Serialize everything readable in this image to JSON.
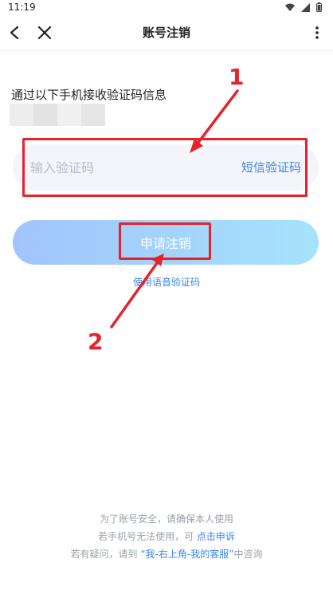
{
  "status_bar": {
    "time": "11:19"
  },
  "nav": {
    "title": "账号注销"
  },
  "info": {
    "text": "通过以下手机接收验证码信息"
  },
  "code_field": {
    "placeholder": "输入验证码",
    "sms_label": "短信验证码"
  },
  "apply_button": {
    "label": "申请注销"
  },
  "voice_link": {
    "label": "使用语音验证码"
  },
  "annotations": {
    "one": "1",
    "two": "2"
  },
  "footer": {
    "line1": "为了账号安全，请确保本人使用",
    "line2_prefix": "若手机号无法使用，可 ",
    "line2_link": "点击申诉",
    "line3_prefix": "若有疑问，请到 ",
    "line3_link": "“我-右上角-我的客服”",
    "line3_suffix": "中咨询"
  },
  "colors": {
    "accent_blue": "#3a86ef",
    "annotation_red": "#e8222a",
    "button_gradient_start": "#a1c4fd",
    "button_gradient_end": "#a6e3fb"
  },
  "icons": [
    "wifi-icon",
    "signal-icon",
    "battery-icon",
    "back-arrow-icon",
    "close-icon",
    "more-vertical-icon"
  ]
}
